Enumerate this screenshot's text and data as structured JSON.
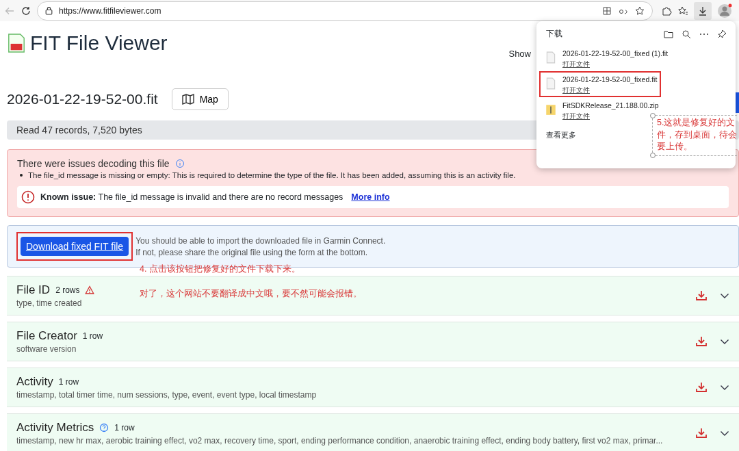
{
  "browser": {
    "url": "https://www.fitfileviewer.com"
  },
  "header": {
    "title": "FIT File Viewer",
    "cut_text": "Show"
  },
  "file": {
    "name": "2026-01-22-19-52-00.fit",
    "map_button": "Map"
  },
  "summary": "Read 47 records, 7,520 bytes",
  "issues": {
    "title": "There were issues decoding this file",
    "items": [
      "The file_id message is missing or empty: This is required to determine the type of the file. It has been added, assuming this is an activity file."
    ],
    "known_issue": {
      "label": "Known issue:",
      "text": "The file_id message is invalid and there are no record messages",
      "link": "More info"
    }
  },
  "download": {
    "button": "Download fixed FIT file",
    "lines": [
      "You should be able to import the downloaded file in Garmin Connect.",
      "If not, please share the original file using the form at the bottom."
    ]
  },
  "annotations": [
    "4. 点击该按钮把修复好的文件下载下来。",
    "对了，这个网站不要翻译成中文哦，要不然可能会报错。"
  ],
  "sections": [
    {
      "title": "File ID",
      "count": "2 rows",
      "warning": true,
      "help": false,
      "fields": "type, time created"
    },
    {
      "title": "File Creator",
      "count": "1 row",
      "warning": false,
      "help": false,
      "fields": "software version"
    },
    {
      "title": "Activity",
      "count": "1 row",
      "warning": false,
      "help": false,
      "fields": "timestamp, total timer time, num sessions, type, event, event type, local timestamp"
    },
    {
      "title": "Activity Metrics",
      "count": "1 row",
      "warning": false,
      "help": true,
      "fields": "timestamp, new hr max, aerobic training effect, vo2 max, recovery time, sport, ending performance condition, anaerobic training effect, ending body battery, first vo2 max, primar..."
    }
  ],
  "downloads_panel": {
    "title": "下载",
    "items": [
      {
        "kind": "file",
        "name": "2026-01-22-19-52-00_fixed (1).fit",
        "action": "打开文件",
        "highlighted": false
      },
      {
        "kind": "file",
        "name": "2026-01-22-19-52-00_fixed.fit",
        "action": "打开文件",
        "highlighted": true
      },
      {
        "kind": "zip",
        "name": "FitSDKRelease_21.188.00.zip",
        "action": "打开文件",
        "highlighted": false
      }
    ],
    "more": "查看更多",
    "note": "5.这就是修复好的文件，存到桌面，待会要上传。"
  }
}
